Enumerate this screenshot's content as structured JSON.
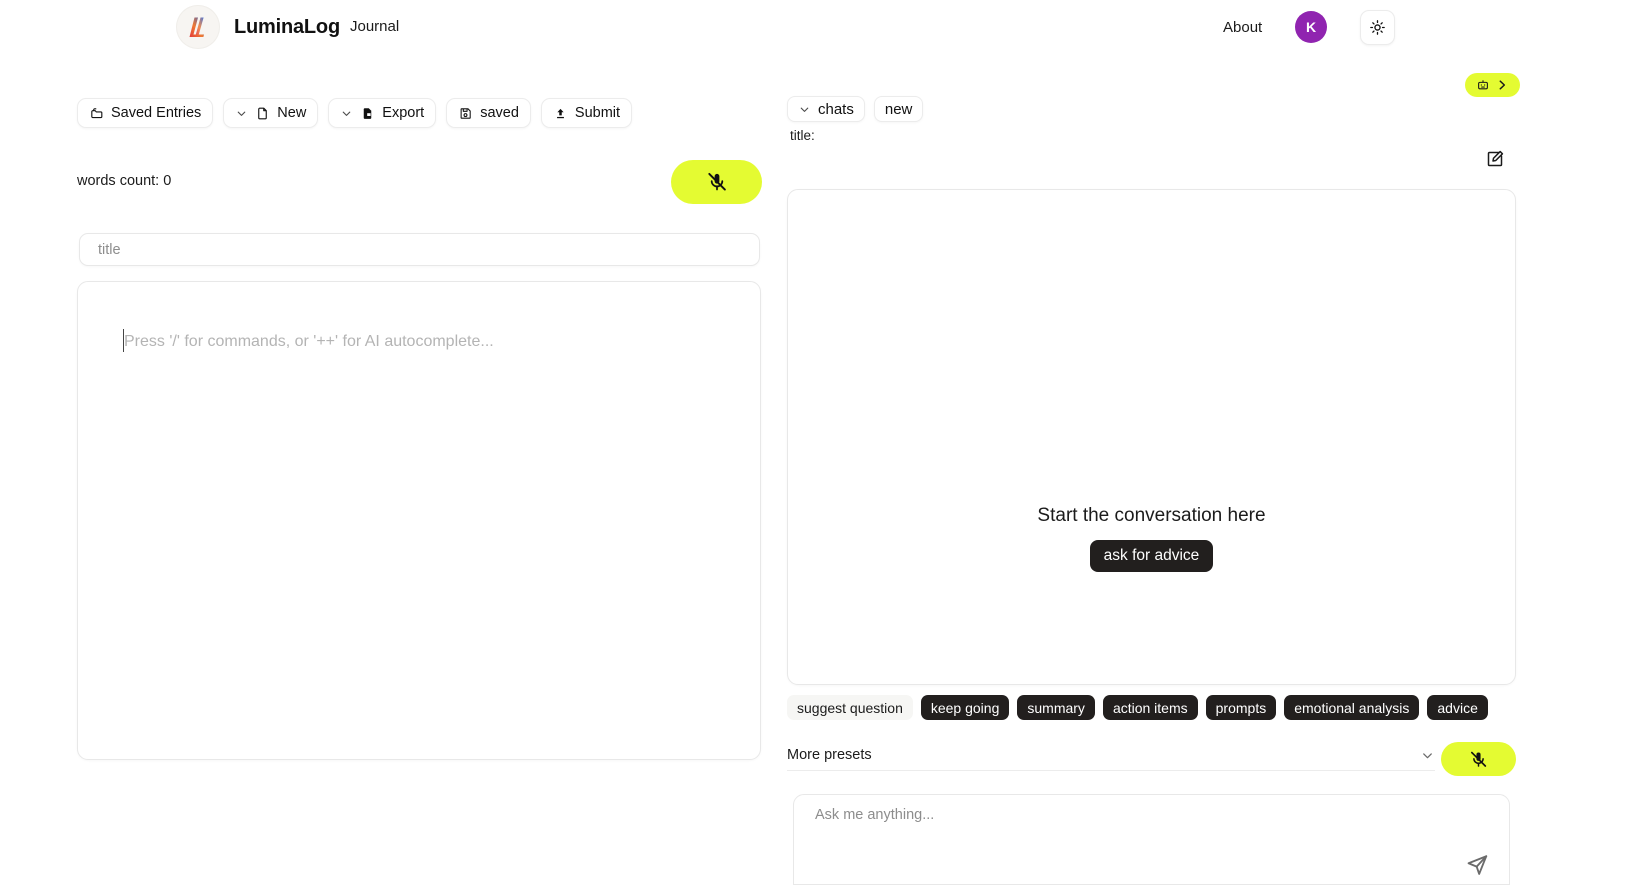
{
  "header": {
    "brand_name": "LuminaLog",
    "logo_icon": "luminalog-gradient-l-logo",
    "nav_journal": "Journal",
    "nav_about": "About",
    "avatar_initial": "K",
    "avatar_color": "#9024b0",
    "theme_icon": "sun-icon"
  },
  "editor": {
    "toolbar": [
      {
        "label": "Saved Entries",
        "icon": "folder-icon",
        "chevron": false
      },
      {
        "label": "New",
        "icon": "file-icon",
        "chevron": true
      },
      {
        "label": "Export",
        "icon": "file-export-icon",
        "chevron": true
      },
      {
        "label": "saved",
        "icon": "save-disk-icon",
        "chevron": false
      },
      {
        "label": "Submit",
        "icon": "upload-icon",
        "chevron": false
      }
    ],
    "words_count": "words count: 0",
    "mic_icon": "mic-off-icon",
    "title_placeholder": "title",
    "body_placeholder": "Press '/' for commands, or '++' for AI autocomplete..."
  },
  "chat": {
    "tabs": [
      {
        "label": "chats",
        "chevron": true
      },
      {
        "label": "new",
        "chevron": false
      }
    ],
    "title_label": "title:",
    "bot_pill": {
      "bot_icon": "robot-icon",
      "arrow_icon": "chevron-right-icon",
      "color": "#e4fb32"
    },
    "edit_icon": "edit-square-icon",
    "empty_title": "Start the conversation here",
    "ask_advice_label": "ask for advice",
    "presets": [
      {
        "label": "suggest question",
        "style": "light"
      },
      {
        "label": "keep going",
        "style": "dark"
      },
      {
        "label": "summary",
        "style": "dark"
      },
      {
        "label": "action items",
        "style": "dark"
      },
      {
        "label": "prompts",
        "style": "dark"
      },
      {
        "label": "emotional analysis",
        "style": "dark"
      },
      {
        "label": "advice",
        "style": "dark"
      }
    ],
    "more_presets_label": "More presets",
    "more_presets_chevron": "chevron-down-icon",
    "mic_icon": "mic-off-icon",
    "ask_placeholder": "Ask me anything...",
    "send_icon": "send-icon"
  }
}
